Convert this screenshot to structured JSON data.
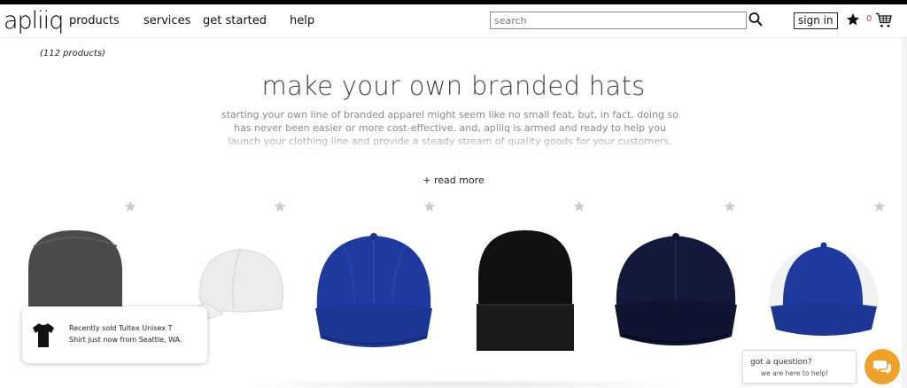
{
  "header": {
    "logo": "apliiq",
    "nav": [
      "products",
      "services",
      "get started",
      "help"
    ],
    "search_placeholder": "search",
    "signin_label": "sign in",
    "cart_count": "0"
  },
  "main": {
    "product_count": "(112 products)",
    "title": "make your own branded hats",
    "description": "starting your own line of branded apparel might seem like no small feat, but, in fact, doing so has never been easier or more cost-effective. and, apliiq is armed and ready to help you launch your clothing line and provide a steady stream of quality goods for your customers. with masters of product sourcing and branding by your side, worrying about paying upfront",
    "read_more": "+ read more"
  },
  "products": [
    {
      "type": "beanie",
      "color": "#4a4a4a"
    },
    {
      "type": "dad-cap",
      "color": "#ececec"
    },
    {
      "type": "cap",
      "color": "#1e3a9e"
    },
    {
      "type": "beanie-cuff",
      "color": "#111111"
    },
    {
      "type": "cap",
      "color": "#14183a"
    },
    {
      "type": "trucker",
      "color": "#1e3a9e"
    }
  ],
  "toast": {
    "line1": "Recently sold Tultex Unisex T",
    "line2": "Shirt just now from Seattle, WA."
  },
  "chat": {
    "title": "got a question?",
    "subtitle": "we are here to help!"
  },
  "colors": {
    "accent": "#f0a12a",
    "cart_count": "#dd3333",
    "star_inactive": "#cccccc"
  }
}
